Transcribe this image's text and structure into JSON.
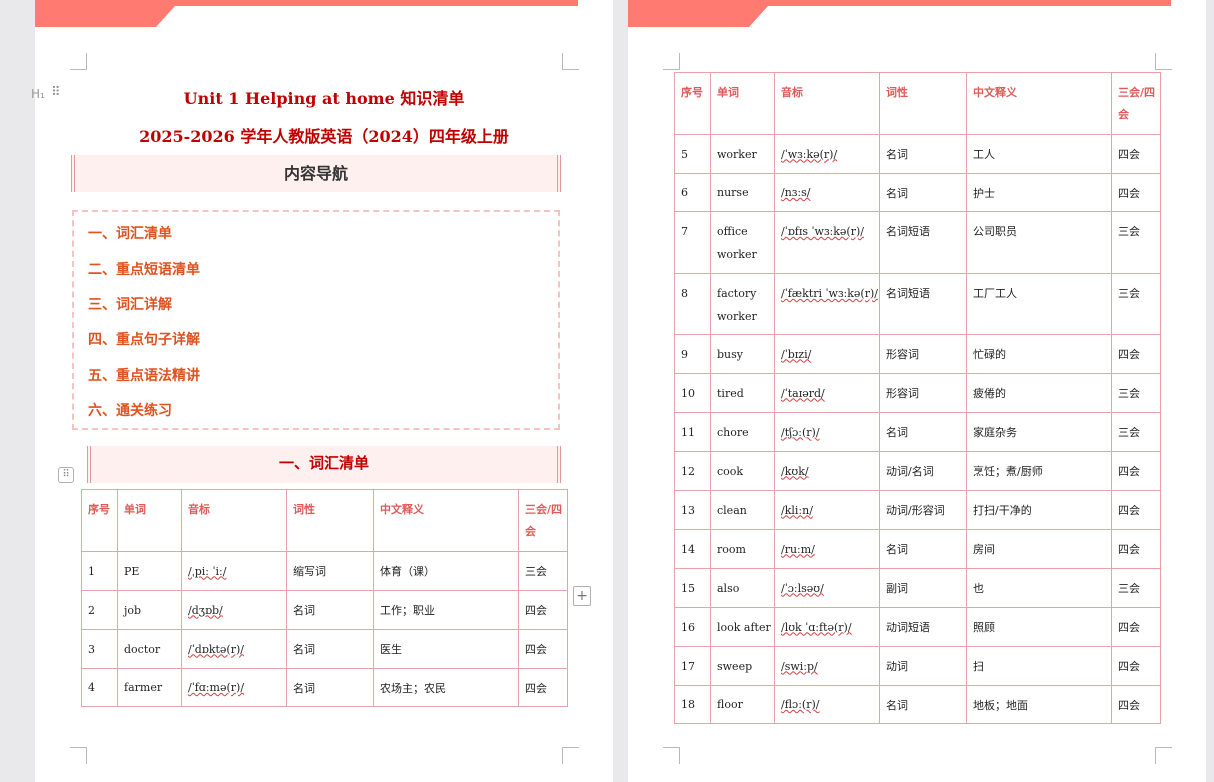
{
  "document": {
    "title_line1": "Unit 1 Helping at home  知识清单",
    "title_line2": "2025-2026 学年人教版英语（2024）四年级上册",
    "nav_title": "内容导航",
    "nav_items": [
      "一、词汇清单",
      "二、重点短语清单",
      "三、词汇详解",
      "四、重点句子详解",
      "五、重点语法精讲",
      "六、通关练习"
    ],
    "section_title": "一、词汇清单",
    "table_headers": [
      "序号",
      "单词",
      "音标",
      "词性",
      "中文释义",
      "三会/四会"
    ],
    "table_rows_page1": [
      [
        "1",
        "PE",
        "/ˌpiː ˈiː/",
        "缩写词",
        "体育（课）",
        "三会"
      ],
      [
        "2",
        "job",
        "/dʒɒb/",
        "名词",
        "工作；职业",
        "四会"
      ],
      [
        "3",
        "doctor",
        "/ˈdɒktə(r)/",
        "名词",
        "医生",
        "四会"
      ],
      [
        "4",
        "farmer",
        "/ˈfɑːmə(r)/",
        "名词",
        "农场主；农民",
        "四会"
      ]
    ],
    "table_rows_page2": [
      [
        "5",
        "worker",
        "/ˈwɜːkə(r)/",
        "名词",
        "工人",
        "四会"
      ],
      [
        "6",
        "nurse",
        "/nɜːs/",
        "名词",
        "护士",
        "四会"
      ],
      [
        "7",
        "office worker",
        "/ˈɒfɪs ˈwɜːkə(r)/",
        "名词短语",
        "公司职员",
        "三会"
      ],
      [
        "8",
        "factory worker",
        "/ˈfæktri ˈwɜːkə(r)/",
        "名词短语",
        "工厂工人",
        "三会"
      ],
      [
        "9",
        "busy",
        "/ˈbɪzi/",
        "形容词",
        "忙碌的",
        "四会"
      ],
      [
        "10",
        "tired",
        "/ˈtaɪərd/",
        "形容词",
        "疲倦的",
        "三会"
      ],
      [
        "11",
        "chore",
        "/tʃɔː(r)/",
        "名词",
        "家庭杂务",
        "三会"
      ],
      [
        "12",
        "cook",
        "/kʊk/",
        "动词/名词",
        "烹饪；煮/厨师",
        "四会"
      ],
      [
        "13",
        "clean",
        "/kliːn/",
        "动词/形容词",
        "打扫/干净的",
        "四会"
      ],
      [
        "14",
        "room",
        "/ruːm/",
        "名词",
        "房间",
        "四会"
      ],
      [
        "15",
        "also",
        "/ˈɔːlsəʊ/",
        "副词",
        "也",
        "三会"
      ],
      [
        "16",
        "look after",
        "/lʊk ˈɑːftə(r)/",
        "动词短语",
        "照顾",
        "四会"
      ],
      [
        "17",
        "sweep",
        "/swiːp/",
        "动词",
        "扫",
        "四会"
      ],
      [
        "18",
        "floor",
        "/flɔː(r)/",
        "名词",
        "地板；地面",
        "四会"
      ]
    ]
  },
  "editor": {
    "heading_marker": "H₁",
    "drag_icon": "drag-handle-icon",
    "table_handle_icon": "table-move-icon",
    "add_icon": "plus-icon"
  },
  "colors": {
    "band": "#ff7b72",
    "title": "#c00000",
    "nav_text": "#e0521f",
    "header_text": "#e05a5a",
    "table_border": "#e8a3a7"
  }
}
